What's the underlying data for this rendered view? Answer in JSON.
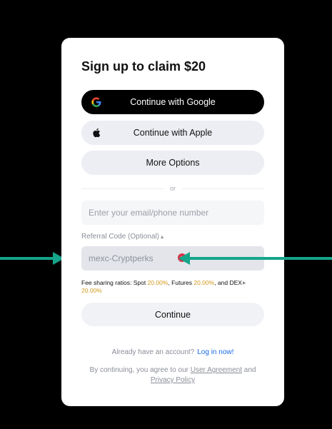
{
  "form": {
    "title": "Sign up to claim $20",
    "google_label": "Continue with Google",
    "apple_label": "Continue with Apple",
    "more_label": "More Options",
    "divider_text": "or",
    "email_placeholder": "Enter your email/phone number",
    "referral_label": "Referral Code (Optional)",
    "referral_caret": "▴",
    "referral_value": "mexc-Cryptperks",
    "fee": {
      "prefix": "Fee sharing ratios: Spot ",
      "spot": "20.00%",
      "mid1": ", Futures ",
      "futures": "20.00%",
      "mid2": ", and DEX+ ",
      "dex": "20.00%"
    },
    "continue_label": "Continue",
    "already_text": "Already have an account?",
    "login_link": "Log in now!",
    "terms_prefix": "By continuing, you agree to our ",
    "user_agreement": "User Agreement",
    "terms_and": " and ",
    "privacy_policy": "Privacy Policy"
  },
  "colors": {
    "background": "#000000",
    "card": "#ffffff",
    "highlight": "#d29a1a",
    "link": "#1769e6",
    "arrow": "#14a58a",
    "clear_icon": "#d9324a"
  },
  "icons": [
    "google-icon",
    "apple-icon",
    "clear-icon",
    "arrow-right-icon",
    "arrow-left-icon"
  ]
}
